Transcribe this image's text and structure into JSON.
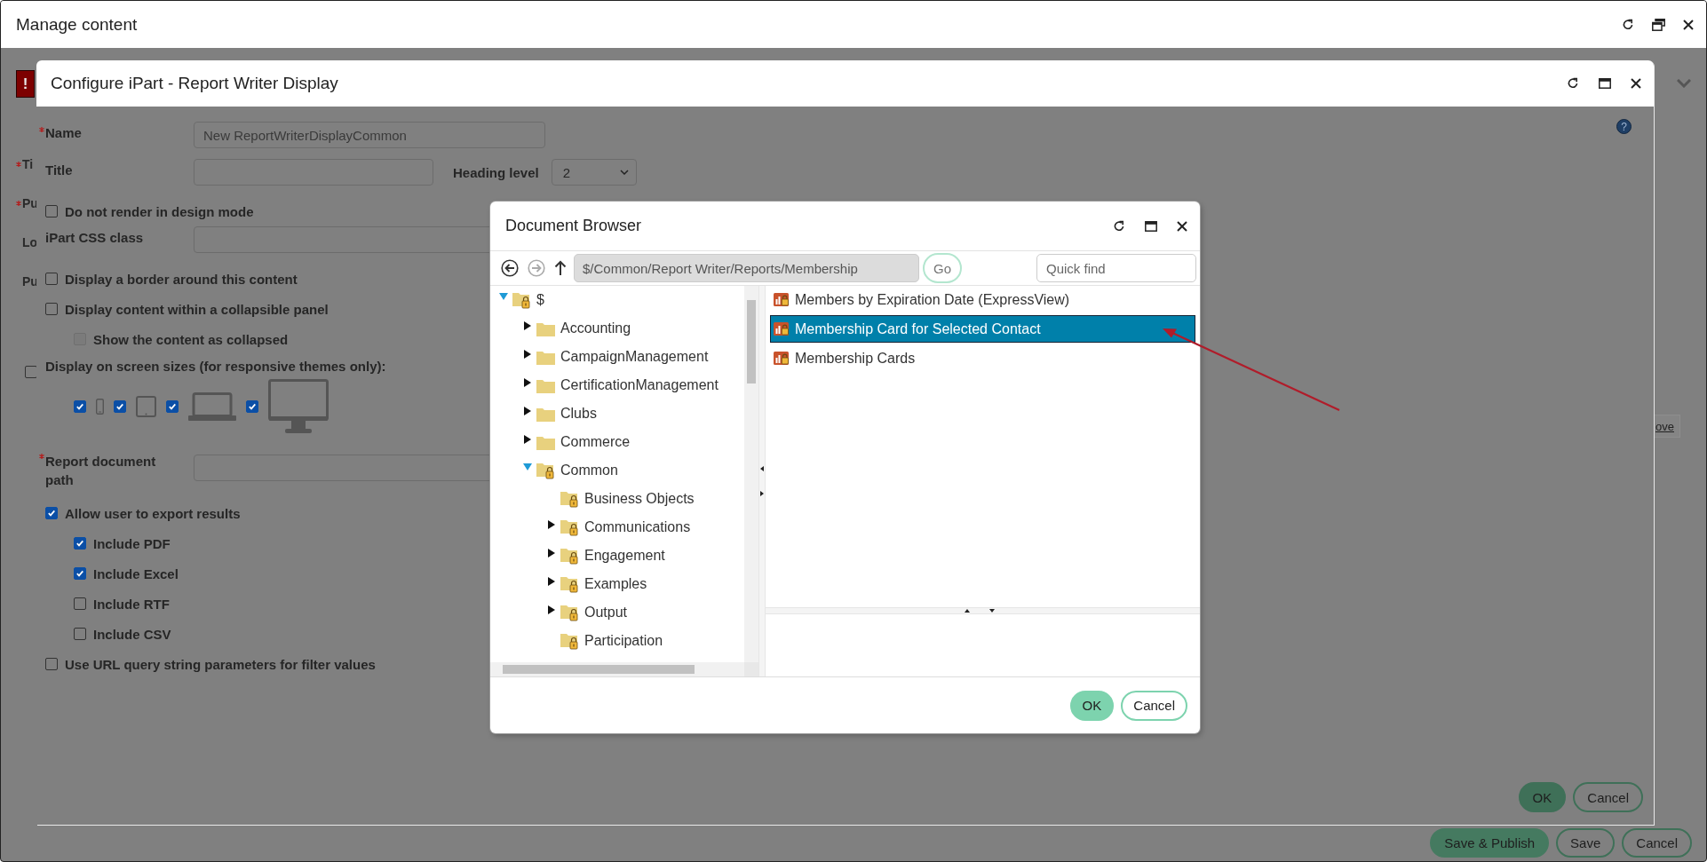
{
  "window": {
    "title": "Manage content"
  },
  "background": {
    "alert": "!",
    "labels": [
      {
        "text": "Ti",
        "required": true
      },
      {
        "text": "Pu",
        "required": true
      },
      {
        "text": "Lo",
        "required": false
      },
      {
        "text": "Pu",
        "required": false
      }
    ],
    "checkbox": {
      "checked": false
    },
    "link": "ove",
    "buttons": [
      {
        "label": "Save & Publish",
        "primary": true
      },
      {
        "label": "Save",
        "primary": false
      },
      {
        "label": "Cancel",
        "primary": false
      }
    ]
  },
  "ipart_dialog": {
    "title": "Configure iPart - Report Writer Display",
    "help": "?",
    "rows": [
      {
        "kind": "text",
        "label": "Name",
        "required": true,
        "value": "New ReportWriterDisplayCommon"
      },
      {
        "kind": "title",
        "label": "Title",
        "value": "",
        "select_label": "Heading level",
        "select_value": "2"
      },
      {
        "kind": "checkbox",
        "label": "Do not render in design mode",
        "checked": false
      },
      {
        "kind": "text",
        "label": "iPart CSS class",
        "required": false,
        "value": ""
      },
      {
        "kind": "checkbox",
        "label": "Display a border around this content",
        "checked": false
      },
      {
        "kind": "checkbox",
        "label": "Display content within a collapsible panel",
        "checked": false,
        "children": [
          {
            "label": "Show the content as collapsed",
            "checked": false,
            "disabled": true
          }
        ]
      },
      {
        "kind": "devices",
        "label": "Display on screen sizes (for responsive themes only):",
        "devices": [
          {
            "kind": "phone",
            "checked": true
          },
          {
            "kind": "tablet",
            "checked": true
          },
          {
            "kind": "laptop",
            "checked": true
          },
          {
            "kind": "monitor",
            "checked": true
          }
        ]
      },
      {
        "kind": "text",
        "label": "Report document path",
        "required": true,
        "value": ""
      },
      {
        "kind": "checkbox",
        "label": "Allow user to export results",
        "checked": true,
        "children": [
          {
            "label": "Include PDF",
            "checked": true,
            "disabled": false
          },
          {
            "label": "Include Excel",
            "checked": true,
            "disabled": false
          },
          {
            "label": "Include RTF",
            "checked": false,
            "disabled": false
          },
          {
            "label": "Include CSV",
            "checked": false,
            "disabled": false
          }
        ]
      },
      {
        "kind": "checkbox",
        "label": "Use URL query string parameters for filter values",
        "checked": false
      }
    ],
    "buttons": [
      {
        "label": "OK",
        "primary": true
      },
      {
        "label": "Cancel",
        "primary": false
      }
    ]
  },
  "document_browser": {
    "title": "Document Browser",
    "path": "$/Common/Report Writer/Reports/Membership",
    "go": "Go",
    "quick_find_placeholder": "Quick find",
    "tree": {
      "label": "$",
      "locked": true,
      "has_children": true,
      "expanded": true,
      "children": [
        {
          "label": "Accounting",
          "locked": false,
          "has_children": true,
          "expanded": false
        },
        {
          "label": "CampaignManagement",
          "locked": false,
          "has_children": true,
          "expanded": false
        },
        {
          "label": "CertificationManagement",
          "locked": false,
          "has_children": true,
          "expanded": false
        },
        {
          "label": "Clubs",
          "locked": false,
          "has_children": true,
          "expanded": false
        },
        {
          "label": "Commerce",
          "locked": false,
          "has_children": true,
          "expanded": false
        },
        {
          "label": "Common",
          "locked": true,
          "has_children": true,
          "expanded": true,
          "children": [
            {
              "label": "Business Objects",
              "locked": true,
              "has_children": false
            },
            {
              "label": "Communications",
              "locked": true,
              "has_children": true,
              "expanded": false
            },
            {
              "label": "Engagement",
              "locked": true,
              "has_children": true,
              "expanded": false
            },
            {
              "label": "Examples",
              "locked": true,
              "has_children": true,
              "expanded": false
            },
            {
              "label": "Output",
              "locked": true,
              "has_children": true,
              "expanded": false
            },
            {
              "label": "Participation",
              "locked": true,
              "has_children": false
            }
          ]
        }
      ]
    },
    "files": [
      {
        "label": "Members by Expiration Date (ExpressView)",
        "selected": false
      },
      {
        "label": "Membership Card for Selected Contact",
        "selected": true
      },
      {
        "label": "Membership Cards",
        "selected": false
      }
    ],
    "buttons": [
      {
        "label": "OK",
        "primary": true
      },
      {
        "label": "Cancel",
        "primary": false
      }
    ]
  }
}
